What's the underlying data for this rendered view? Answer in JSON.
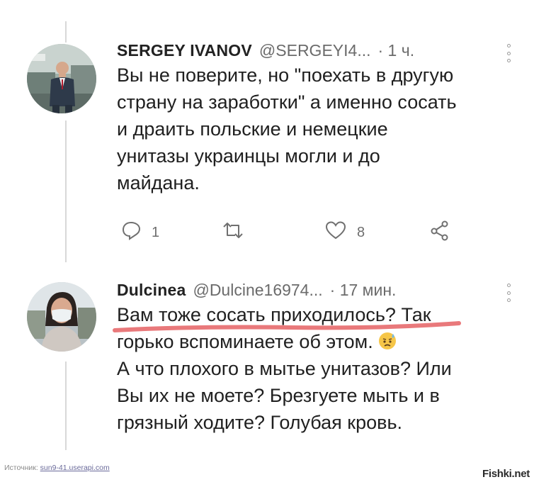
{
  "tweets": [
    {
      "name": "SERGEY IVANOV",
      "handle": "@SERGEYI4...",
      "time": "· 1 ч.",
      "lines": [
        "Вы не поверите, но \"поехать в другую",
        "страну на заработки\" а именно сосать",
        "и драить польские и немецкие",
        "унитазы украинцы могли и до",
        "майдана."
      ],
      "replies": "1",
      "retweets": "",
      "likes": "8"
    },
    {
      "name": "Dulcinea",
      "handle": "@Dulcine16974...",
      "time": "· 17 мин.",
      "lines": [
        "Вам тоже сосать приходилось? Так",
        "горько вспоминаете об этом.",
        "А что плохого в мытье унитазов? Или",
        "Вы их не моете? Брезгуете мыть и в",
        "грязный ходите? Голубая кровь."
      ],
      "emoji": "sad-sweat-emoji"
    }
  ],
  "highlight_color": "#e9797b",
  "footer": {
    "source_label": "Источник:",
    "source_link": "sun9-41.userapi.com",
    "watermark": "Fishki.net"
  }
}
